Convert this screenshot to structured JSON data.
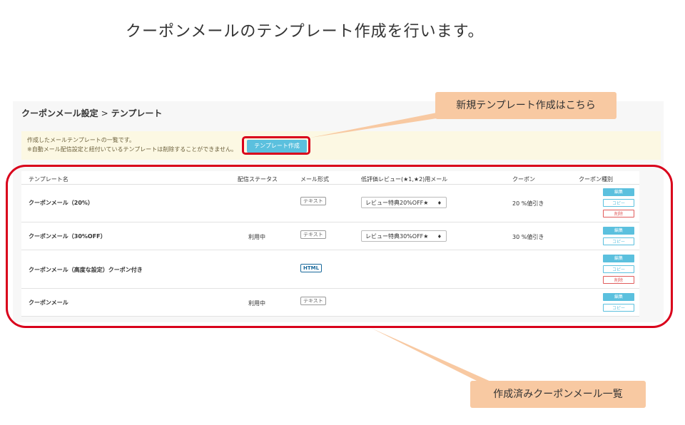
{
  "heading": "クーポンメールのテンプレート作成を行います。",
  "breadcrumb": {
    "parent": "クーポンメール設定",
    "separator": ">",
    "current": "テンプレート"
  },
  "notice": {
    "line1": "作成したメールテンプレートの一覧です。",
    "line2": "※自動メール配信設定と紐付いているテンプレートは削除することができません。"
  },
  "create_button": "テンプレート作成",
  "table": {
    "headers": [
      "テンプレート名",
      "配信ステータス",
      "メール形式",
      "低評価レビュー(★1,★2)用メール",
      "クーポン",
      "クーポン種別"
    ],
    "rows": [
      {
        "name": "クーポンメール（20%）",
        "status": "",
        "format": "テキスト",
        "review_select": "レビュー特典20%OFF★",
        "coupon": "20 %値引き",
        "actions": [
          "編集",
          "コピー",
          "削除"
        ]
      },
      {
        "name": "クーポンメール（30%OFF）",
        "status": "利用中",
        "format": "テキスト",
        "review_select": "レビュー特典30%OFF★",
        "coupon": "30 %値引き",
        "actions": [
          "編集",
          "コピー"
        ]
      },
      {
        "name": "クーポンメール（高度な設定）クーポン付き",
        "status": "",
        "format": "HTML",
        "review_select": "",
        "coupon": "",
        "actions": [
          "編集",
          "コピー",
          "削除"
        ]
      },
      {
        "name": "クーポンメール",
        "status": "利用中",
        "format": "テキスト",
        "review_select": "",
        "coupon": "",
        "actions": [
          "編集",
          "コピー"
        ]
      }
    ]
  },
  "callouts": {
    "new_template": "新規テンプレート作成はこちら",
    "list": "作成済みクーポンメール一覧"
  },
  "colors": {
    "accent": "#5bc0de",
    "highlight": "#d9001b",
    "callout": "#f8c9a2",
    "notice_bg": "#fcf8e3"
  }
}
